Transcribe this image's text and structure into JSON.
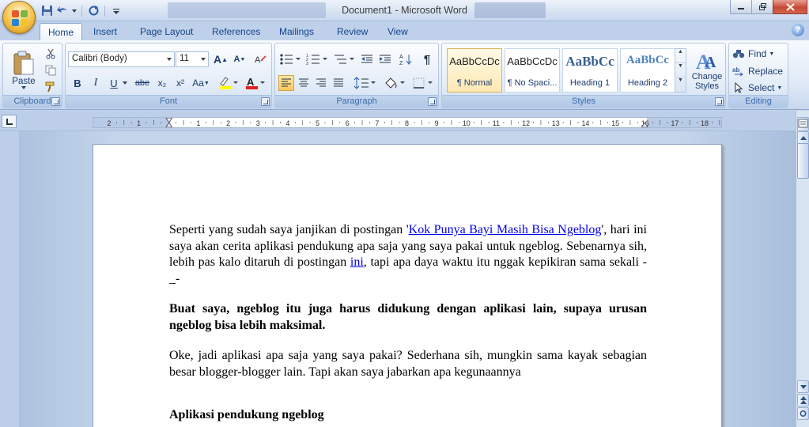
{
  "window": {
    "title": "Document1 - Microsoft Word"
  },
  "ribbon_tabs": [
    {
      "label": "Home",
      "active": true
    },
    {
      "label": "Insert"
    },
    {
      "label": "Page Layout"
    },
    {
      "label": "References"
    },
    {
      "label": "Mailings"
    },
    {
      "label": "Review"
    },
    {
      "label": "View"
    }
  ],
  "clipboard": {
    "paste_label": "Paste",
    "group_label": "Clipboard"
  },
  "font": {
    "name": "Calibri (Body)",
    "size": "11",
    "group_label": "Font",
    "bold": "B",
    "italic": "I",
    "underline": "U",
    "strike": "abe",
    "subscript": "x₂",
    "superscript": "x²",
    "change_case": "Aa",
    "grow": "A",
    "shrink": "A"
  },
  "paragraph": {
    "group_label": "Paragraph"
  },
  "styles": {
    "group_label": "Styles",
    "items": [
      {
        "sample": "AaBbCcDc",
        "name": "¶ Normal"
      },
      {
        "sample": "AaBbCcDc",
        "name": "¶ No Spaci..."
      },
      {
        "sample": "AaBbCc",
        "name": "Heading 1"
      },
      {
        "sample": "AaBbCc",
        "name": "Heading 2"
      }
    ],
    "change_styles": "Change Styles"
  },
  "editing": {
    "find": "Find",
    "replace": "Replace",
    "select": "Select",
    "group_label": "Editing"
  },
  "ruler": {
    "labels": [
      "2",
      "1",
      "",
      "1",
      "2",
      "3",
      "4",
      "5",
      "6",
      "7",
      "8",
      "9",
      "10",
      "11",
      "12",
      "13",
      "14",
      "15",
      "16",
      "17",
      "18"
    ]
  },
  "document": {
    "p1_a": "Seperti yang sudah saya janjikan di postingan '",
    "p1_link1": "Kok Punya Bayi Masih Bisa Ngeblog",
    "p1_b": "', hari ini saya akan cerita aplikasi pendukung apa saja yang saya pakai untuk ngeblog. Sebenarnya sih, lebih pas kalo ditaruh di postingan ",
    "p1_link2": "ini",
    "p1_c": ", tapi apa daya waktu itu nggak kepikiran sama sekali -_-",
    "p2": "Buat saya, ngeblog itu juga harus didukung dengan aplikasi lain, supaya urusan ngeblog bisa lebih maksimal.",
    "p3": "Oke, jadi aplikasi apa saja yang saya pakai? Sederhana sih, mungkin sama kayak sebagian besar blogger-blogger lain. Tapi akan saya jabarkan apa kegunaannya",
    "heading": "Aplikasi pendukung ngeblog"
  },
  "colors": {
    "accent": "#15428b",
    "link": "#0000ee",
    "highlight": "#ffff00",
    "font_color": "#e02020"
  }
}
